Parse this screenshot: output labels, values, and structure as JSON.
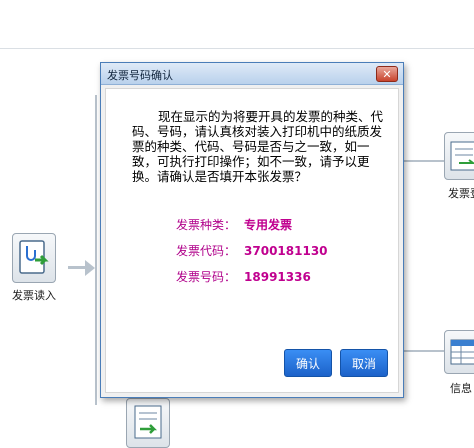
{
  "background": {
    "left_node_label": "发票读入",
    "right_top_label": "发票登",
    "right_bottom_label": "信息"
  },
  "dialog": {
    "title": "发票号码确认",
    "close_symbol": "✕",
    "message": "现在显示的为将要开具的发票的种类、代码、号码，请认真核对装入打印机中的纸质发票的种类、代码、号码是否与之一致，如一致，可执行打印操作；如不一致，请予以更换。请确认是否填开本张发票？",
    "fields": [
      {
        "label": "发票种类：",
        "value": "专用发票"
      },
      {
        "label": "发票代码：",
        "value": "3700181130"
      },
      {
        "label": "发票号码：",
        "value": "18991336"
      }
    ],
    "confirm_label": "确认",
    "cancel_label": "取消"
  },
  "colors": {
    "accent": "#1c62c9",
    "field_text": "#c0008f"
  }
}
